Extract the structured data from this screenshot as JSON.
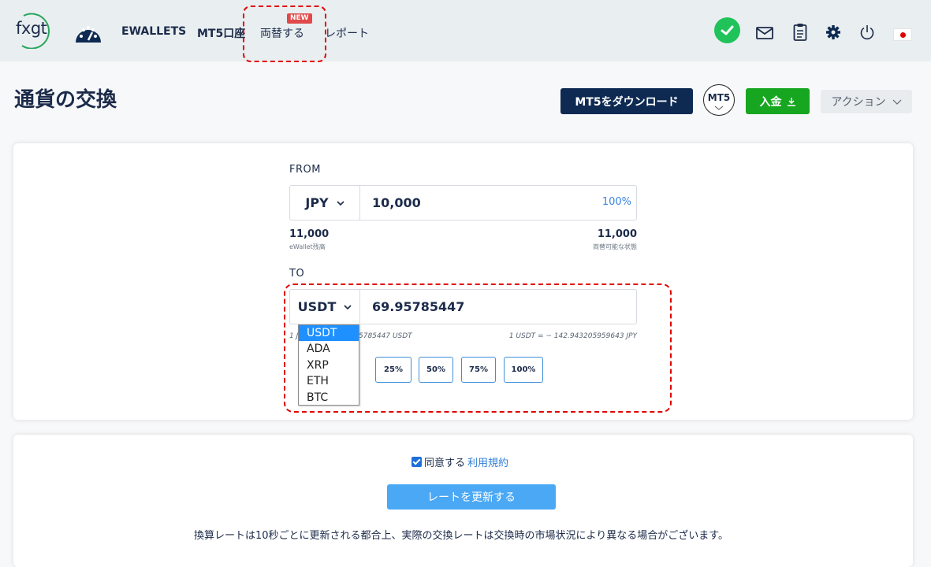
{
  "nav": {
    "logo_text": "fxgt",
    "ewallets": "EWALLETS",
    "mt5_account": "MT5口座",
    "exchange": "両替する",
    "new_badge": "NEW",
    "report": "レポート"
  },
  "header": {
    "title": "通貨の交換",
    "download_label": "MT5をダウンロード",
    "mt5_badge": "MT5",
    "deposit_label": "入金",
    "action_label": "アクション"
  },
  "from": {
    "label": "FROM",
    "currency": "JPY",
    "amount": "10,000",
    "percent": "100%",
    "ewallet_balance": "11,000",
    "ewallet_balance_label": "eWallet残高",
    "exchangeable": "11,000",
    "exchangeable_label": "両替可能な状態"
  },
  "to": {
    "label": "TO",
    "currency": "USDT",
    "amount": "69.95785447",
    "rate_left_prefix": "1 J",
    "rate_left_suffix": "5785447 USDT",
    "rate_right": "1 USDT = ~ 142.943205959643 JPY",
    "dropdown_options": [
      "USDT",
      "ADA",
      "XRP",
      "ETH",
      "BTC"
    ],
    "percent_buttons": [
      "25%",
      "50%",
      "75%",
      "100%"
    ]
  },
  "footer": {
    "agree_label": "同意する",
    "terms_link": "利用規約",
    "refresh_label": "レートを更新する",
    "disclaimer": "換算レートは10秒ごとに更新される都合上、実際の交換レートは交換時の市場状況により異なる場合がございます。"
  },
  "colors": {
    "navy": "#0e2a52",
    "green": "#17a620",
    "blue_link": "#2f7fd8",
    "refresh_blue": "#4aa8f5",
    "highlight_red": "#e00000"
  }
}
